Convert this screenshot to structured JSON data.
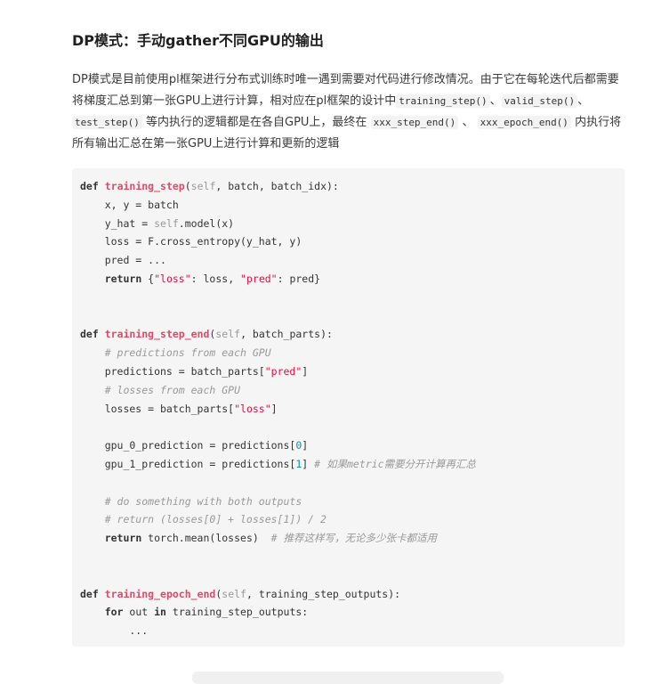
{
  "heading": "DP模式：手动gather不同GPU的输出",
  "paragraph": {
    "t1": "DP模式是目前使用pl框架进行分布式训练时唯一遇到需要对代码进行修改情况。由于它在每轮迭代后都需要将梯度汇总到第一张GPU上进行计算，相对应在pl框架的设计中",
    "c1": "training_step()",
    "s1": "、",
    "c2": "valid_step()",
    "s2": "、",
    "c3": "test_step()",
    "t2": "等内执行的逻辑都是在各自GPU上，最终在",
    "c4": "xxx_step_end()",
    "s3": "、",
    "c5": "xxx_epoch_end()",
    "t3": "内执行将所有输出汇总在第一张GPU上进行计算和更新的逻辑"
  },
  "code": {
    "l1": [
      "def",
      " ",
      "training_step",
      "(",
      "self",
      ", batch, batch_idx):"
    ],
    "l2": "    x, y = batch",
    "l3": [
      "    y_hat = ",
      "self",
      ".model(x)"
    ],
    "l4": "    loss = F.cross_entropy(y_hat, y)",
    "l5": "    pred = ...",
    "l6": [
      "    ",
      "return",
      " {",
      "\"loss\"",
      ": loss, ",
      "\"pred\"",
      ": pred}"
    ],
    "l9": [
      "def",
      " ",
      "training_step_end",
      "(",
      "self",
      ", batch_parts):"
    ],
    "l10": "    # predictions from each GPU",
    "l11": [
      "    predictions = batch_parts[",
      "\"pred\"",
      "]"
    ],
    "l12": "    # losses from each GPU",
    "l13": [
      "    losses = batch_parts[",
      "\"loss\"",
      "]"
    ],
    "l15": [
      "    gpu_0_prediction = predictions[",
      "0",
      "]"
    ],
    "l16": [
      "    gpu_1_prediction = predictions[",
      "1",
      "] ",
      "# 如果metric需要分开计算再汇总"
    ],
    "l18": "    # do something with both outputs",
    "l19": "    # return (losses[0] + losses[1]) / 2",
    "l20": [
      "    ",
      "return",
      " torch.mean(losses)  ",
      "# 推荐这样写，无论多少张卡都适用"
    ],
    "l23": [
      "def",
      " ",
      "training_epoch_end",
      "(",
      "self",
      ", training_step_outputs):"
    ],
    "l24": [
      "    ",
      "for",
      " out ",
      "in",
      " training_step_outputs:"
    ],
    "l25": "        ..."
  }
}
